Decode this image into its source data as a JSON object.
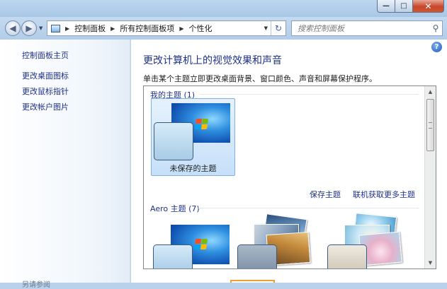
{
  "window": {
    "minimize": "—",
    "maximize": "□",
    "close": "✕"
  },
  "nav": {
    "back_icon": "◀",
    "forward_icon": "▶",
    "history_icon": "▼"
  },
  "address": {
    "crumbs": [
      "控制面板",
      "所有控制面板项",
      "个性化"
    ],
    "separator": "▶",
    "dropdown_icon": "▼",
    "refresh_icon": "↻"
  },
  "search": {
    "placeholder": "搜索控制面板",
    "icon": "⚲"
  },
  "sidebar": {
    "home": "控制面板主页",
    "links": [
      "更改桌面图标",
      "更改鼠标指针",
      "更改帐户图片"
    ],
    "see_also": "另请参阅"
  },
  "main": {
    "help_icon": "?",
    "title": "更改计算机上的视觉效果和声音",
    "description": "单击某个主题立即更改桌面背景、窗口颜色、声音和屏幕保护程序。",
    "my_themes": {
      "label": "我的主题 (1)",
      "tiles": [
        {
          "name": "未保存的主题",
          "selected": true
        }
      ]
    },
    "save_theme": "保存主题",
    "get_more": "联机获取更多主题",
    "aero_themes": {
      "label": "Aero 主题 (7)"
    }
  },
  "scrollbar": {
    "up": "▲",
    "down": "▼"
  },
  "colors": {
    "link": "#1e3287",
    "selection_border": "#7fb2e3",
    "window_frame": "#b9d1ea"
  }
}
